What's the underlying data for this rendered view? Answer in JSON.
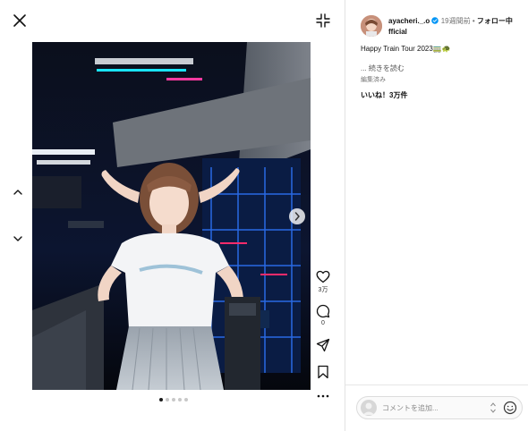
{
  "post": {
    "username": "ayacheri._.official",
    "username_line1": "ayacheri._.o",
    "username_line2": "fficial",
    "time_ago": "19週間前",
    "follow_label": "フォロー中",
    "caption": "Happy Train Tour 2023🚃🐢",
    "more_label": "... 続きを読む",
    "edited_label": "編集済み",
    "likes_label": "いいね！3万件"
  },
  "actions": {
    "like_count": "3万",
    "comment_count": "0"
  },
  "carousel": {
    "total": 5,
    "current": 1
  },
  "comment": {
    "placeholder": "コメントを追加..."
  },
  "colors": {
    "verified_blue": "#0095f6",
    "text_dark": "#111111",
    "text_muted": "#737373"
  }
}
